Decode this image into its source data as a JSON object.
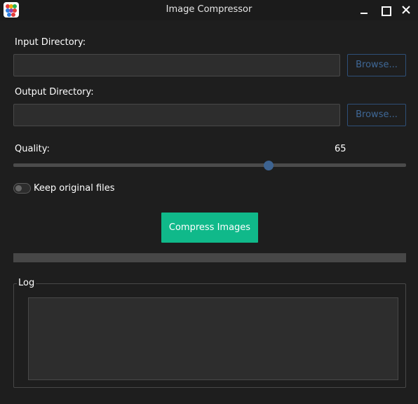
{
  "window": {
    "title": "Image Compressor",
    "icon": "app-dots-icon",
    "controls": [
      "minimize-icon",
      "maximize-icon",
      "close-icon"
    ]
  },
  "input": {
    "label": "Input Directory:",
    "value": "",
    "browse_label": "Browse..."
  },
  "output": {
    "label": "Output Directory:",
    "value": "",
    "browse_label": "Browse..."
  },
  "quality": {
    "label": "Quality:",
    "value": "65",
    "fraction": 0.65
  },
  "keep_original": {
    "label": "Keep original files",
    "checked": false
  },
  "compress_button": {
    "label": "Compress Images"
  },
  "progress": {
    "fraction": 0
  },
  "log": {
    "title": "Log",
    "content": ""
  },
  "colors": {
    "background": "#1e1e1e",
    "field": "#2d2d2d",
    "accent": "#10b98a",
    "browse_border": "#2e4f78",
    "slider_knob": "#3d6391"
  }
}
